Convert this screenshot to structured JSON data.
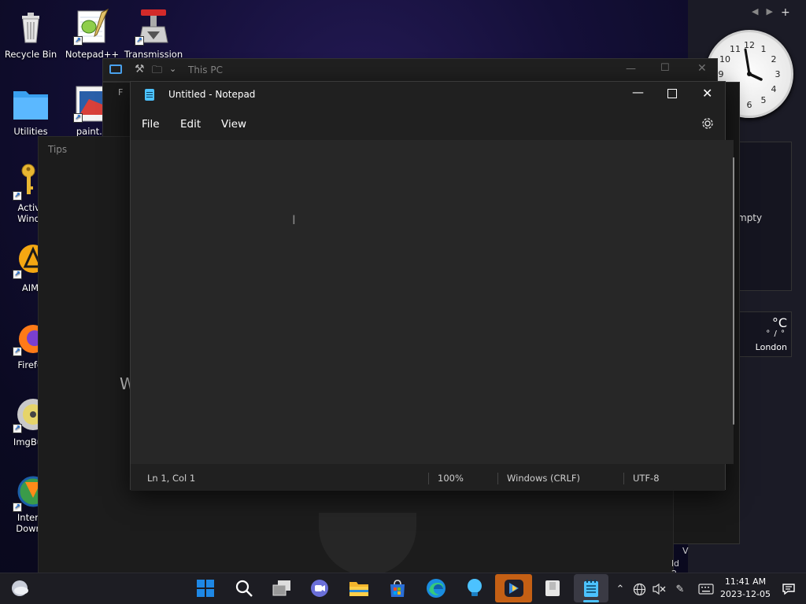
{
  "desktop": {
    "icons": [
      {
        "label": "Recycle Bin"
      },
      {
        "label": "Notepad++"
      },
      {
        "label": "Transmission"
      },
      {
        "label": "Utilities"
      },
      {
        "label": "paint.n"
      },
      {
        "label": "Activa\nWindo"
      },
      {
        "label": "AIMP"
      },
      {
        "label": "Firefo"
      },
      {
        "label": "ImgBu"
      },
      {
        "label": "Intern\nDownl"
      }
    ]
  },
  "widgets": {
    "nav": {
      "prev": "◀",
      "next": "▶",
      "add": "+"
    },
    "recycle_text": "mpty",
    "weather": {
      "unit": "°C",
      "value": "° / °",
      "city": "London"
    },
    "clock_numbers": [
      "12",
      "1",
      "2",
      "3",
      "4",
      "5",
      "6",
      "7",
      "8",
      "9",
      "10",
      "11"
    ]
  },
  "explorer": {
    "title": "This PC",
    "partial_text": "F"
  },
  "tips": {
    "title": "Tips",
    "partial_text": "W"
  },
  "background_partial": {
    "v": "V",
    "ld": "ld 2"
  },
  "notepad": {
    "title": "Untitled - Notepad",
    "menu": [
      "File",
      "Edit",
      "View"
    ],
    "content": "",
    "status": {
      "position": "Ln 1, Col 1",
      "zoom": "100%",
      "line_ending": "Windows (CRLF)",
      "encoding": "UTF-8"
    }
  },
  "taskbar": {
    "time": "11:41 AM",
    "date": "2023-12-05",
    "apps": [
      "start-icon",
      "search-icon",
      "task-view-icon",
      "teams-icon",
      "file-explorer-icon",
      "store-icon",
      "edge-icon",
      "tips-icon",
      "potplayer-icon",
      "app-icon",
      "notepad-icon"
    ]
  },
  "colors": {
    "accent": "#4cc2ff",
    "window_bg": "#202020",
    "editor_bg": "#272727",
    "taskbar": "#1d1d23"
  }
}
